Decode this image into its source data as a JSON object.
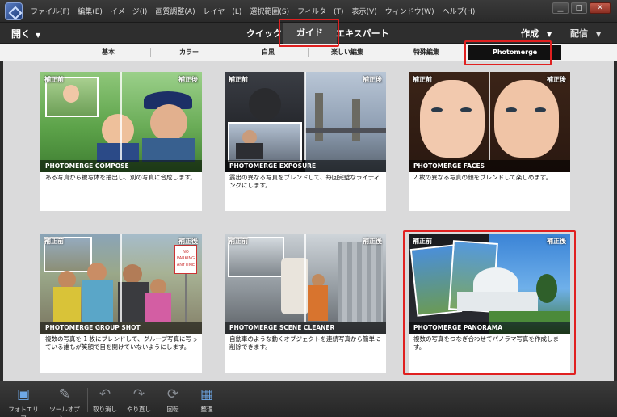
{
  "menu": {
    "items": [
      "ファイル(F)",
      "編集(E)",
      "イメージ(I)",
      "画質調整(A)",
      "レイヤー(L)",
      "選択範囲(S)",
      "フィルター(T)",
      "表示(V)",
      "ウィンドウ(W)",
      "ヘルプ(H)"
    ]
  },
  "window_controls": {
    "minimize": "▁",
    "maximize": "□",
    "close": "✕"
  },
  "modebar": {
    "open_label": "開く",
    "quick_label": "クイック",
    "guide_label": "ガイド",
    "expert_label": "エキスパート",
    "create_label": "作成",
    "share_label": "配信"
  },
  "categories": {
    "basic": "基本",
    "color": "カラー",
    "bw": "白黒",
    "fun": "楽しい編集",
    "special": "特殊編集",
    "photomerge": "Photomerge"
  },
  "cards": [
    {
      "before": "補正前",
      "after": "補正後",
      "title": "PHOTOMERGE COMPOSE",
      "desc": "ある写真から被写体を抽出し、別の写真に合成します。"
    },
    {
      "before": "補正前",
      "after": "補正後",
      "title": "PHOTOMERGE EXPOSURE",
      "desc": "露出の異なる写真をブレンドして、毎回完璧なライティングにします。"
    },
    {
      "before": "補正前",
      "after": "補正後",
      "title": "PHOTOMERGE FACES",
      "desc": "2 枚の異なる写真の顔をブレンドして楽しめます。"
    },
    {
      "before": "補正前",
      "after": "補正後",
      "title": "PHOTOMERGE GROUP SHOT",
      "desc": "複数の写真を 1 枚にブレンドして、グループ写真に写っている誰もが笑顔で目を開けていないようにします。"
    },
    {
      "before": "補正前",
      "after": "補正後",
      "title": "PHOTOMERGE SCENE CLEANER",
      "desc": "自動車のような動くオブジェクトを連続写真から簡単に削除できます。"
    },
    {
      "before": "補正前",
      "after": "補正後",
      "title": "PHOTOMERGE PANORAMA",
      "desc": "複数の写真をつなぎ合わせてパノラマ写真を作成します。"
    }
  ],
  "sign_text": "NO PARKING ANYTIME",
  "toolbar": {
    "photo_area": "フォトエリア",
    "tool_options": "ツールオプシ...",
    "undo": "取り消し",
    "redo": "やり直し",
    "rotate": "回転",
    "organize": "整理"
  },
  "colors": {
    "highlight": "#e02020",
    "accent_icon": "#6ea8e8"
  }
}
